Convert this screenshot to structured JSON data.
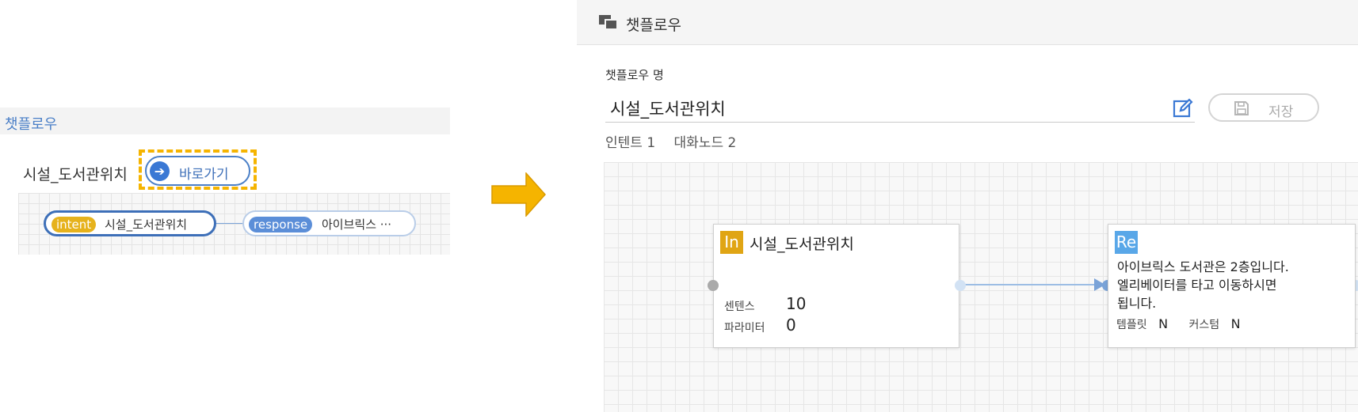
{
  "left": {
    "header": "챗플로우",
    "flow_name": "시설_도서관위치",
    "shortcut_label": "바로가기",
    "intent_tag": "intent",
    "intent_text": "시설_도서관위치",
    "response_tag": "response",
    "response_text": "아이브릭스 ···"
  },
  "right": {
    "header_title": "챗플로우",
    "name_label": "챗플로우 명",
    "name_value": "시설_도서관위치",
    "save_label": "저장",
    "stats": {
      "intent": "인텐트 1",
      "dialog_node": "대화노드 2"
    },
    "intent_node": {
      "badge": "In",
      "title": "시설_도서관위치",
      "sentence_label": "센텐스",
      "sentence_value": "10",
      "param_label": "파라미터",
      "param_value": "0"
    },
    "response_node": {
      "badge": "Re",
      "text_line1": "아이브릭스 도서관은 2층입니다.",
      "text_line2": "엘리베이터를 타고 이동하시면",
      "text_line3": "됩니다.",
      "template_label": "템플릿",
      "template_value": "N",
      "custom_label": "커스텀",
      "custom_value": "N"
    }
  },
  "colors": {
    "accent_blue": "#3d6fb8",
    "highlight": "#f5b400",
    "intent_badge": "#e0a514",
    "response_badge": "#59a7e8"
  },
  "icons": [
    "chat-bubbles-icon",
    "arrow-right-circle-icon",
    "edit-icon",
    "save-icon",
    "big-right-arrow"
  ]
}
